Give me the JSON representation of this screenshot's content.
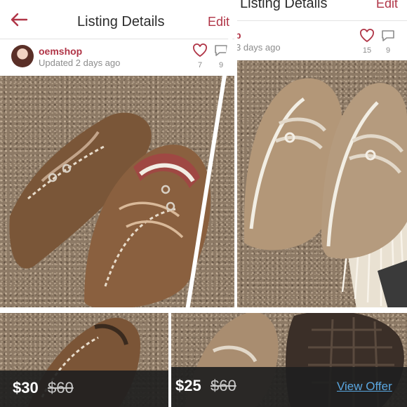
{
  "header": {
    "title_left": "Listing Details",
    "title_right": "Listing Details",
    "edit_left": "Edit",
    "edit_right": "Edit"
  },
  "seller": {
    "username": "oemshop",
    "username_partial": "p",
    "updated_left": "Updated 2 days ago",
    "updated_right": "3 days ago"
  },
  "stats": {
    "left_likes": "7",
    "left_comments": "9",
    "right_likes": "15",
    "right_comments": "9"
  },
  "listings": [
    {
      "price": "$30",
      "original_price": "$60"
    },
    {
      "price": "$25",
      "original_price": "$60",
      "action": "View Offer"
    }
  ],
  "colors": {
    "accent": "#b03547",
    "link": "#5aa7e0",
    "price_bar": "#202020"
  }
}
